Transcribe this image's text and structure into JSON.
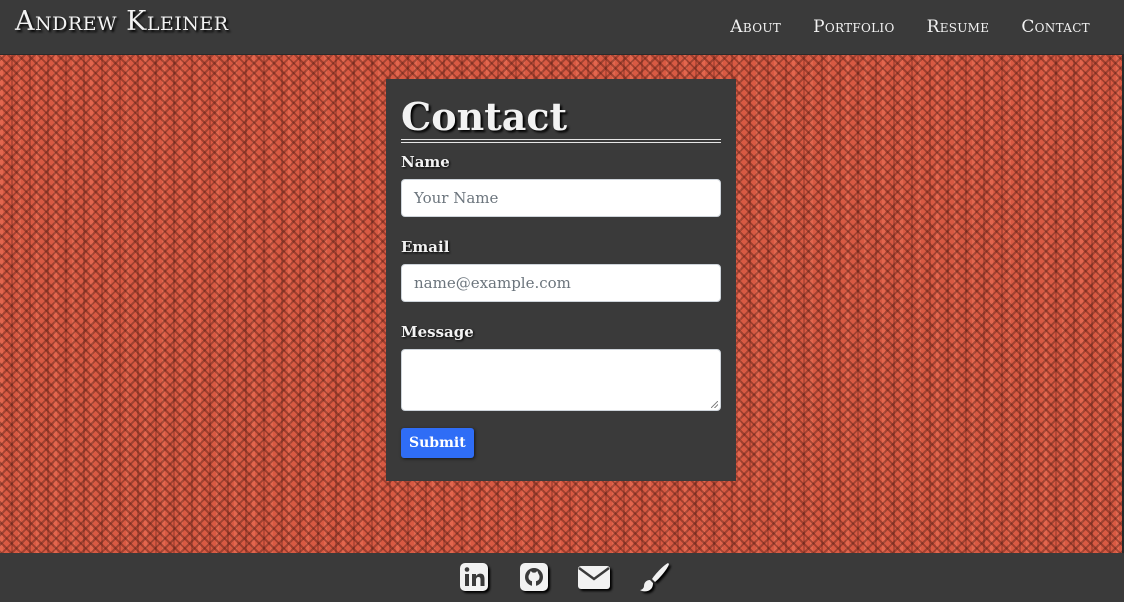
{
  "navbar": {
    "brand": "Andrew Kleiner",
    "links": [
      "About",
      "Portfolio",
      "Resume",
      "Contact"
    ]
  },
  "contact_form": {
    "title": "Contact",
    "name_label": "Name",
    "name_placeholder": "Your Name",
    "email_label": "Email",
    "email_placeholder": "name@example.com",
    "message_label": "Message",
    "submit_label": "Submit"
  },
  "footer": {
    "icons": [
      "linkedin-icon",
      "github-icon",
      "email-icon",
      "paintbrush-icon"
    ]
  },
  "colors": {
    "bar_background": "#3a3a3a",
    "hero_background": "#d85a43",
    "submit_button": "#2f6df6",
    "text_light": "#f2f2f2"
  }
}
